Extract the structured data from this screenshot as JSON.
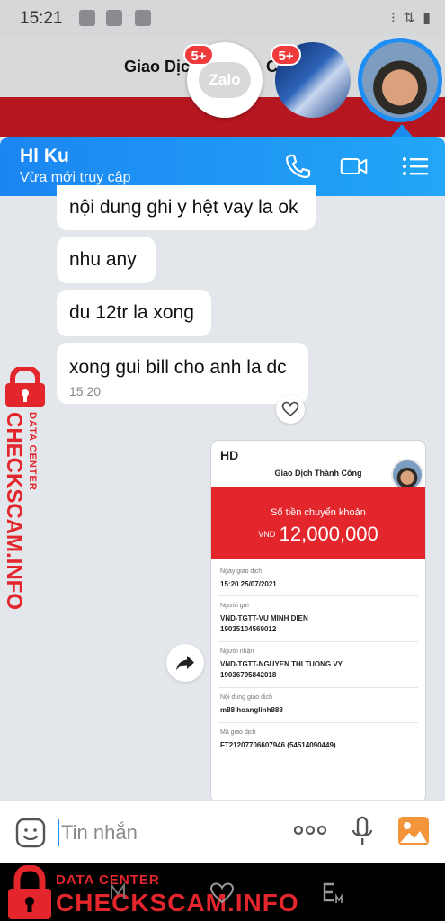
{
  "status_bar": {
    "time": "15:21",
    "right_icons": "⁝ ⇅ ▮"
  },
  "background_app": {
    "title_left": "Giao Dịc",
    "title_right": "C"
  },
  "chat_heads": [
    {
      "name": "zalo",
      "logo_text": "Zalo",
      "badge": "5+"
    },
    {
      "name": "group-image",
      "badge": "5+"
    },
    {
      "name": "current-contact"
    }
  ],
  "chat_header": {
    "name": "Hl Ku",
    "status": "Vừa mới truy cập"
  },
  "messages": [
    {
      "text": "nội dung ghi y hệt vay la ok"
    },
    {
      "text": "nhu any"
    },
    {
      "text": "du 12tr la xong"
    },
    {
      "text": "xong gui bill cho anh la dc",
      "time": "15:20"
    }
  ],
  "receipt": {
    "hd": "HD",
    "title": "Giao Dịch Thành Công",
    "amount_label": "Số tiền chuyển khoản",
    "currency": "VND",
    "amount": "12,000,000",
    "fields": [
      {
        "key": "Ngày giao dịch",
        "value": "15:20 25/07/2021"
      },
      {
        "key": "Người gửi",
        "value": "VND-TGTT-VU MINH DIEN",
        "value2": "19035104569012"
      },
      {
        "key": "Người nhận",
        "value": "VND-TGTT-NGUYEN THI TUONG VY",
        "value2": "19036795842018"
      },
      {
        "key": "Nội dung giao dịch",
        "value": "m88 hoanglinh888"
      },
      {
        "key": "Mã giao dịch",
        "value": "FT21207706607946 (54514090449)"
      }
    ]
  },
  "input": {
    "placeholder": "Tin nhắn"
  },
  "watermark": {
    "small": "DATA CENTER",
    "big": "CHECKSCAM.INFO"
  },
  "colors": {
    "accent": "#1b86f2",
    "watermark_red": "#e3262c",
    "receipt_red": "#e2262c"
  }
}
